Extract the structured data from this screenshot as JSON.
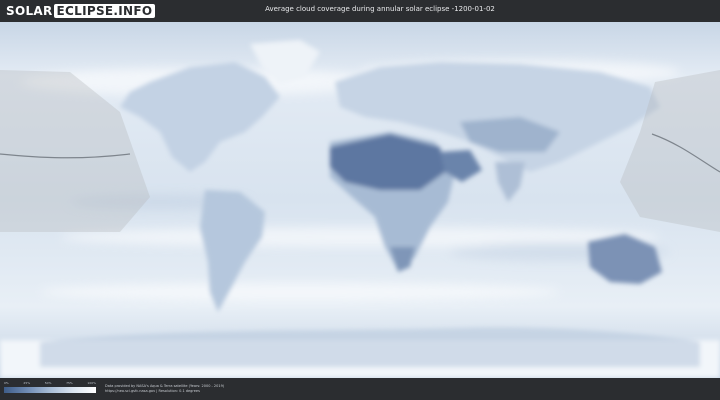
{
  "header": {
    "logo_part1": "SOLAR",
    "logo_part2": "ECLIPSE.INFO",
    "title": "Average cloud coverage during annular solar eclipse -1200-01-02"
  },
  "legend": {
    "ticks": [
      "0%",
      "25%",
      "50%",
      "75%",
      "100%"
    ]
  },
  "footer": {
    "credit_line1": "Data provided by NASA's Aqua & Terra satellite (Years: 2000 - 2019)",
    "credit_line2": "https://neo.sci.gsfc.nasa.gov  |  Resolution: 0.1 degrees"
  },
  "colors": {
    "background": "#2b2d30",
    "ocean_cloud": "#dfe8f2",
    "land_clear": "#55709b",
    "eclipse_path": "#8a8f95"
  }
}
